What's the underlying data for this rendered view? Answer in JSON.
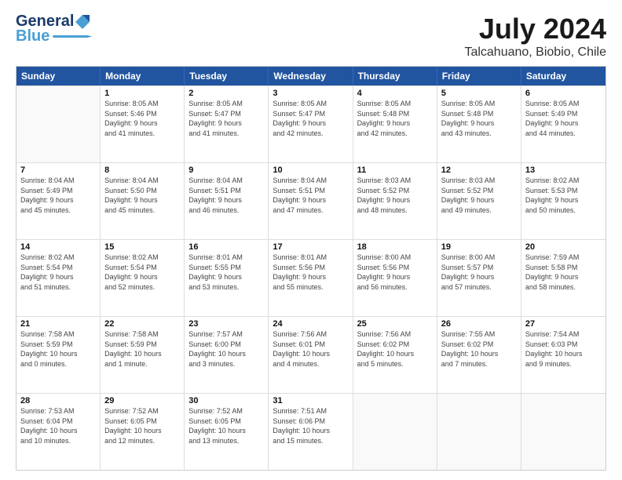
{
  "header": {
    "logo_line1": "General",
    "logo_line2": "Blue",
    "title": "July 2024",
    "subtitle": "Talcahuano, Biobio, Chile"
  },
  "calendar": {
    "days_of_week": [
      "Sunday",
      "Monday",
      "Tuesday",
      "Wednesday",
      "Thursday",
      "Friday",
      "Saturday"
    ],
    "rows": [
      [
        {
          "day": "",
          "info": ""
        },
        {
          "day": "1",
          "info": "Sunrise: 8:05 AM\nSunset: 5:46 PM\nDaylight: 9 hours\nand 41 minutes."
        },
        {
          "day": "2",
          "info": "Sunrise: 8:05 AM\nSunset: 5:47 PM\nDaylight: 9 hours\nand 41 minutes."
        },
        {
          "day": "3",
          "info": "Sunrise: 8:05 AM\nSunset: 5:47 PM\nDaylight: 9 hours\nand 42 minutes."
        },
        {
          "day": "4",
          "info": "Sunrise: 8:05 AM\nSunset: 5:48 PM\nDaylight: 9 hours\nand 42 minutes."
        },
        {
          "day": "5",
          "info": "Sunrise: 8:05 AM\nSunset: 5:48 PM\nDaylight: 9 hours\nand 43 minutes."
        },
        {
          "day": "6",
          "info": "Sunrise: 8:05 AM\nSunset: 5:49 PM\nDaylight: 9 hours\nand 44 minutes."
        }
      ],
      [
        {
          "day": "7",
          "info": "Sunrise: 8:04 AM\nSunset: 5:49 PM\nDaylight: 9 hours\nand 45 minutes."
        },
        {
          "day": "8",
          "info": "Sunrise: 8:04 AM\nSunset: 5:50 PM\nDaylight: 9 hours\nand 45 minutes."
        },
        {
          "day": "9",
          "info": "Sunrise: 8:04 AM\nSunset: 5:51 PM\nDaylight: 9 hours\nand 46 minutes."
        },
        {
          "day": "10",
          "info": "Sunrise: 8:04 AM\nSunset: 5:51 PM\nDaylight: 9 hours\nand 47 minutes."
        },
        {
          "day": "11",
          "info": "Sunrise: 8:03 AM\nSunset: 5:52 PM\nDaylight: 9 hours\nand 48 minutes."
        },
        {
          "day": "12",
          "info": "Sunrise: 8:03 AM\nSunset: 5:52 PM\nDaylight: 9 hours\nand 49 minutes."
        },
        {
          "day": "13",
          "info": "Sunrise: 8:02 AM\nSunset: 5:53 PM\nDaylight: 9 hours\nand 50 minutes."
        }
      ],
      [
        {
          "day": "14",
          "info": "Sunrise: 8:02 AM\nSunset: 5:54 PM\nDaylight: 9 hours\nand 51 minutes."
        },
        {
          "day": "15",
          "info": "Sunrise: 8:02 AM\nSunset: 5:54 PM\nDaylight: 9 hours\nand 52 minutes."
        },
        {
          "day": "16",
          "info": "Sunrise: 8:01 AM\nSunset: 5:55 PM\nDaylight: 9 hours\nand 53 minutes."
        },
        {
          "day": "17",
          "info": "Sunrise: 8:01 AM\nSunset: 5:56 PM\nDaylight: 9 hours\nand 55 minutes."
        },
        {
          "day": "18",
          "info": "Sunrise: 8:00 AM\nSunset: 5:56 PM\nDaylight: 9 hours\nand 56 minutes."
        },
        {
          "day": "19",
          "info": "Sunrise: 8:00 AM\nSunset: 5:57 PM\nDaylight: 9 hours\nand 57 minutes."
        },
        {
          "day": "20",
          "info": "Sunrise: 7:59 AM\nSunset: 5:58 PM\nDaylight: 9 hours\nand 58 minutes."
        }
      ],
      [
        {
          "day": "21",
          "info": "Sunrise: 7:58 AM\nSunset: 5:59 PM\nDaylight: 10 hours\nand 0 minutes."
        },
        {
          "day": "22",
          "info": "Sunrise: 7:58 AM\nSunset: 5:59 PM\nDaylight: 10 hours\nand 1 minute."
        },
        {
          "day": "23",
          "info": "Sunrise: 7:57 AM\nSunset: 6:00 PM\nDaylight: 10 hours\nand 3 minutes."
        },
        {
          "day": "24",
          "info": "Sunrise: 7:56 AM\nSunset: 6:01 PM\nDaylight: 10 hours\nand 4 minutes."
        },
        {
          "day": "25",
          "info": "Sunrise: 7:56 AM\nSunset: 6:02 PM\nDaylight: 10 hours\nand 5 minutes."
        },
        {
          "day": "26",
          "info": "Sunrise: 7:55 AM\nSunset: 6:02 PM\nDaylight: 10 hours\nand 7 minutes."
        },
        {
          "day": "27",
          "info": "Sunrise: 7:54 AM\nSunset: 6:03 PM\nDaylight: 10 hours\nand 9 minutes."
        }
      ],
      [
        {
          "day": "28",
          "info": "Sunrise: 7:53 AM\nSunset: 6:04 PM\nDaylight: 10 hours\nand 10 minutes."
        },
        {
          "day": "29",
          "info": "Sunrise: 7:52 AM\nSunset: 6:05 PM\nDaylight: 10 hours\nand 12 minutes."
        },
        {
          "day": "30",
          "info": "Sunrise: 7:52 AM\nSunset: 6:05 PM\nDaylight: 10 hours\nand 13 minutes."
        },
        {
          "day": "31",
          "info": "Sunrise: 7:51 AM\nSunset: 6:06 PM\nDaylight: 10 hours\nand 15 minutes."
        },
        {
          "day": "",
          "info": ""
        },
        {
          "day": "",
          "info": ""
        },
        {
          "day": "",
          "info": ""
        }
      ]
    ]
  }
}
